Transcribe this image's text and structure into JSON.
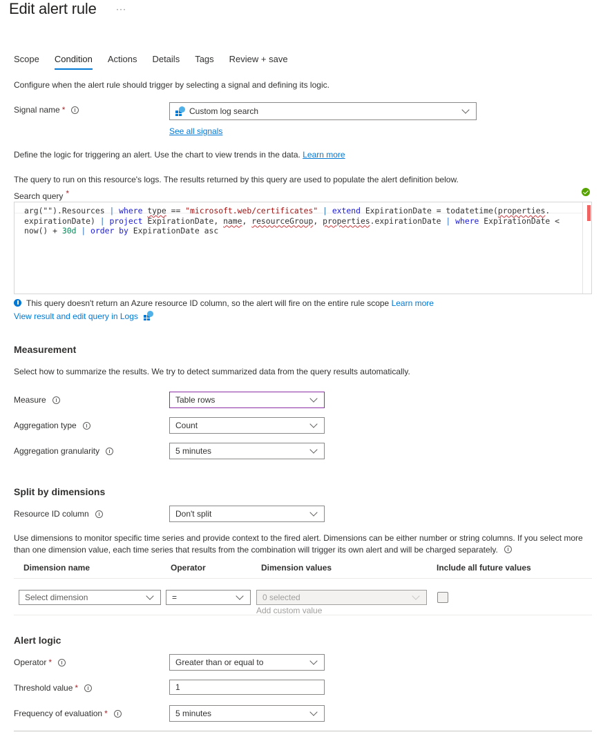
{
  "header": {
    "title": "Edit alert rule",
    "more_label": "···"
  },
  "tabs": [
    {
      "label": "Scope",
      "active": false
    },
    {
      "label": "Condition",
      "active": true
    },
    {
      "label": "Actions",
      "active": false
    },
    {
      "label": "Details",
      "active": false
    },
    {
      "label": "Tags",
      "active": false
    },
    {
      "label": "Review + save",
      "active": false
    }
  ],
  "condition": {
    "intro": "Configure when the alert rule should trigger by selecting a signal and defining its logic.",
    "signal": {
      "label": "Signal name",
      "required_mark": "*",
      "value": "Custom log search",
      "icon": "log-analytics-icon",
      "see_all_link": "See all signals"
    },
    "logic_text": "Define the logic for triggering an alert. Use the chart to view trends in the data.",
    "logic_learn_more": "Learn more",
    "query_text": "The query to run on this resource's logs. The results returned by this query are used to populate the alert definition below.",
    "search_query": {
      "label": "Search query",
      "required_mark": "*",
      "status_icon": "valid-check-icon",
      "lines": [
        "arg(\"\").Resources | where type == \"microsoft.web/certificates\" | extend ExpirationDate = todatetime(properties.",
        "expirationDate) | project ExpirationDate, name, resourceGroup, properties.expirationDate | where ExpirationDate <",
        "now() + 30d | order by ExpirationDate asc"
      ]
    },
    "query_info": "This query doesn't return an Azure resource ID column, so the alert will fire on the entire rule scope",
    "query_info_learn_more": "Learn more",
    "view_in_logs": "View result and edit query in Logs"
  },
  "measurement": {
    "title": "Measurement",
    "description": "Select how to summarize the results. We try to detect summarized data from the query results automatically.",
    "fields": [
      {
        "label": "Measure",
        "value": "Table rows"
      },
      {
        "label": "Aggregation type",
        "value": "Count"
      },
      {
        "label": "Aggregation granularity",
        "value": "5 minutes"
      }
    ]
  },
  "split": {
    "title": "Split by dimensions",
    "resource_id_label": "Resource ID column",
    "resource_id_value": "Don't split",
    "description_line1": "Use dimensions to monitor specific time series and provide context to the fired alert. Dimensions can be either number or string columns. If you select more",
    "description_line2": "than one dimension value, each time series that results from the combination will trigger its own alert and will be charged separately.",
    "columns": [
      "Dimension name",
      "Operator",
      "Dimension values",
      "Include all future values"
    ],
    "row": {
      "dimension_placeholder": "Select dimension",
      "operator_value": "=",
      "values_placeholder": "0 selected",
      "add_custom": "Add custom value",
      "include_future": false
    }
  },
  "alert_logic": {
    "title": "Alert logic",
    "operator_label": "Operator",
    "operator_value": "Greater than or equal to",
    "threshold_label": "Threshold value",
    "threshold_value": "1",
    "frequency_label": "Frequency of evaluation",
    "frequency_value": "5 minutes",
    "required_mark": "*"
  }
}
